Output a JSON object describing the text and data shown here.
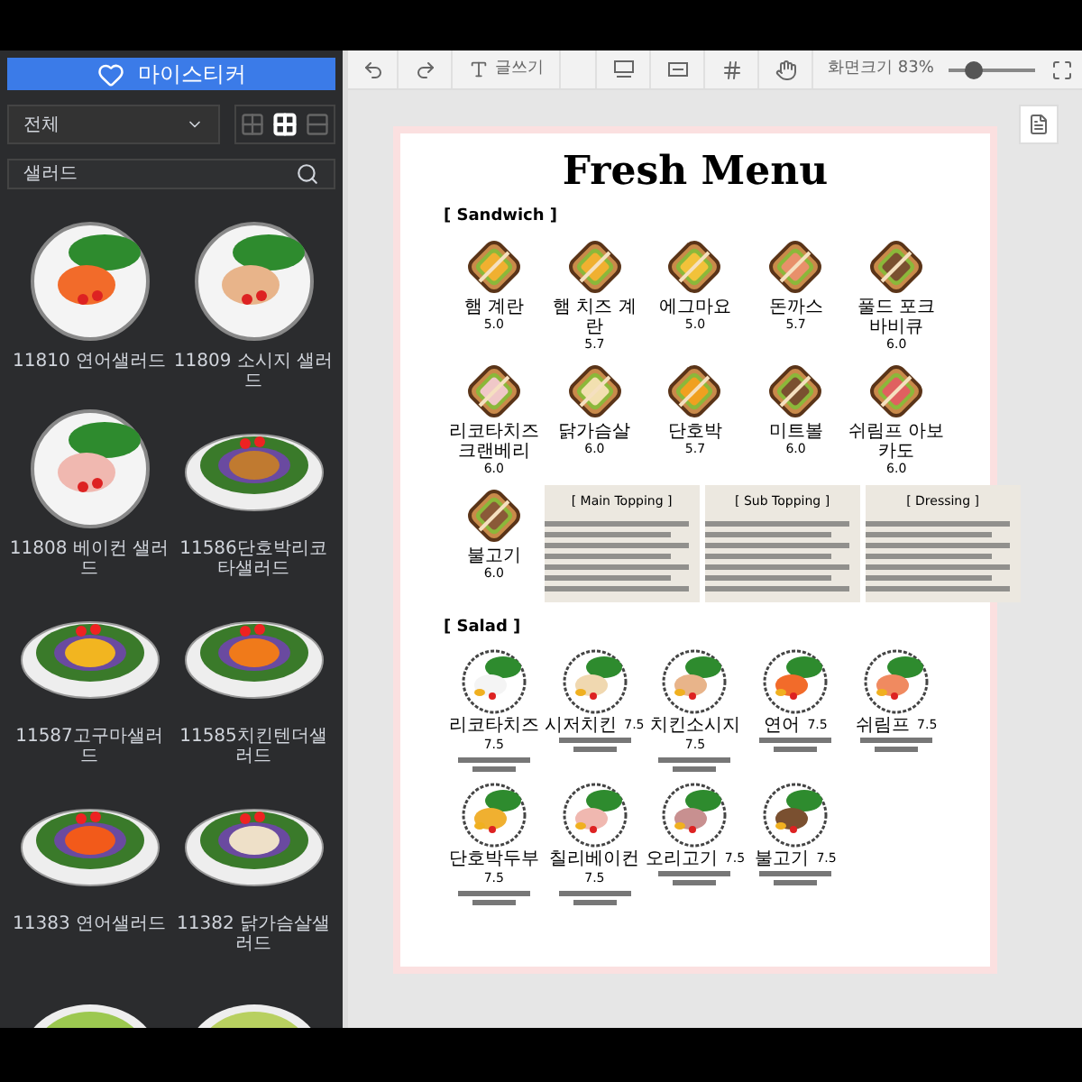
{
  "sidebar": {
    "sticker_button": "마이스티커",
    "filter": {
      "value": "전체"
    },
    "view_modes": [
      {
        "kind": "dense",
        "selected": false
      },
      {
        "kind": "grid",
        "selected": true
      },
      {
        "kind": "list",
        "selected": false
      }
    ],
    "search": {
      "value": "샐러드"
    },
    "stickers": [
      {
        "name": "11810 연어샐러드",
        "kind": "round",
        "color": "#f26b2a"
      },
      {
        "name": "11809 소시지 샐러드",
        "kind": "round",
        "color": "#e8b48a"
      },
      {
        "name": "11808 베이컨 샐러드",
        "kind": "round",
        "color": "#f0b8b0"
      },
      {
        "name": "11586단호박리코타샐러드",
        "kind": "oval",
        "color": "#c07a30"
      },
      {
        "name": "11587고구마샐러드",
        "kind": "oval",
        "color": "#f2b520"
      },
      {
        "name": "11585치킨텐더샐러드",
        "kind": "oval",
        "color": "#f07a1a"
      },
      {
        "name": "11383 연어샐러드",
        "kind": "oval",
        "color": "#f25a1a"
      },
      {
        "name": "11382 닭가슴살샐러드",
        "kind": "oval",
        "color": "#eee0c8"
      },
      {
        "kind": "bowl",
        "color": "#9cc850"
      },
      {
        "kind": "bowl",
        "color": "#b8d060"
      }
    ]
  },
  "toolbar": {
    "write_label": "글쓰기",
    "zoom_label": "화면크기 83%",
    "zoom": {
      "level": 0.3
    }
  },
  "menu": {
    "title": "Fresh Menu",
    "sandwich_heading": "[ Sandwich ]",
    "sandwiches": [
      {
        "name": "햄 계란",
        "price": "5.0",
        "color": "#f0b030"
      },
      {
        "name": "햄 치즈 계란",
        "price": "5.7",
        "color": "#f0b030"
      },
      {
        "name": "에그마요",
        "price": "5.0",
        "color": "#f2c23a"
      },
      {
        "name": "돈까스",
        "price": "5.7",
        "color": "#e8906a"
      },
      {
        "name": "풀드 포크 바비큐",
        "price": "6.0",
        "color": "#7a5030"
      },
      {
        "name": "리코타치즈크랜베리",
        "price": "6.0",
        "color": "#f0c8c8"
      },
      {
        "name": "닭가슴살",
        "price": "6.0",
        "color": "#f2e0b0"
      },
      {
        "name": "단호박",
        "price": "5.7",
        "color": "#f0a020"
      },
      {
        "name": "미트볼",
        "price": "6.0",
        "color": "#7a5030"
      },
      {
        "name": "쉬림프 아보카도",
        "price": "6.0",
        "color": "#e06060"
      },
      {
        "name": "불고기",
        "price": "6.0",
        "color": "#8a5a38"
      }
    ],
    "topping_boxes": [
      {
        "title": "[ Main Topping ]"
      },
      {
        "title": "[ Sub Topping ]"
      },
      {
        "title": "[ Dressing ]"
      }
    ],
    "salad_heading": "[ Salad ]",
    "salads": [
      {
        "name": "리코타치즈",
        "price": "7.5",
        "color": "#f4f4f4"
      },
      {
        "name": "시저치킨",
        "price": "7.5",
        "color": "#f0d8b0"
      },
      {
        "name": "치킨소시지",
        "price": "7.5",
        "color": "#e8b48a"
      },
      {
        "name": "연어",
        "price": "7.5",
        "color": "#f26b2a"
      },
      {
        "name": "쉬림프",
        "price": "7.5",
        "color": "#f08a60"
      },
      {
        "name": "단호박두부",
        "price": "7.5",
        "color": "#f0b030"
      },
      {
        "name": "칠리베이컨",
        "price": "7.5",
        "color": "#f0b8b0"
      },
      {
        "name": "오리고기",
        "price": "7.5",
        "color": "#c89090"
      },
      {
        "name": "불고기",
        "price": "7.5",
        "color": "#7a5030"
      }
    ]
  }
}
